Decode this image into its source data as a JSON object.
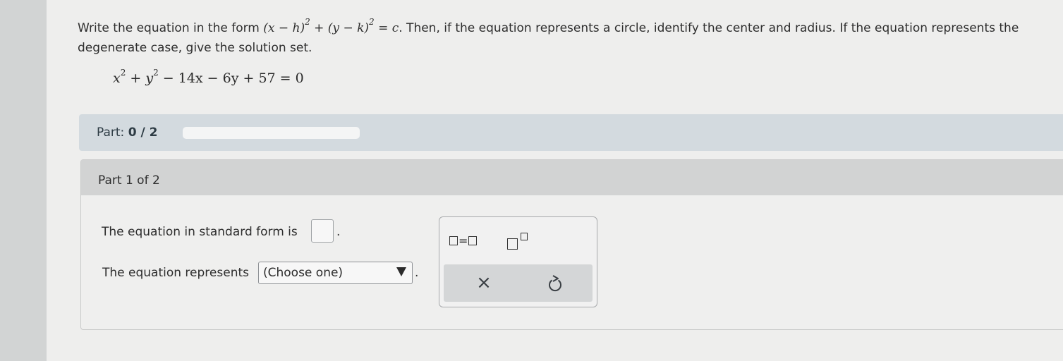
{
  "instructions": {
    "before": "Write the equation in the form ",
    "form_pre": "(x − h)",
    "form_exp1": "2",
    "form_mid": " + (y − k)",
    "form_exp2": "2",
    "form_post": " = c",
    "after": ". Then, if the equation represents a circle, identify the center and radius. If the equation represents the degenerate case, give the solution set."
  },
  "given_equation": {
    "x": "x",
    "exp1": "2",
    "plus_y": " + y",
    "exp2": "2",
    "rest": " − 14x − 6y + 57 = 0"
  },
  "progress": {
    "label": "Part:",
    "value": "0 / 2",
    "fraction": 0,
    "bar_color": "#3d89c9"
  },
  "part": {
    "title": "Part 1 of 2",
    "q1_label": "The equation in standard form is",
    "q1_period": ".",
    "q2_label": "The equation represents",
    "q2_select_value": "(Choose one)",
    "q2_period": "."
  },
  "toolbox": {
    "equals_tool": "=",
    "exponent_tool_icon": "superscript-icon",
    "clear_icon": "close-icon",
    "clear_glyph": "×",
    "undo_icon": "undo-icon"
  }
}
